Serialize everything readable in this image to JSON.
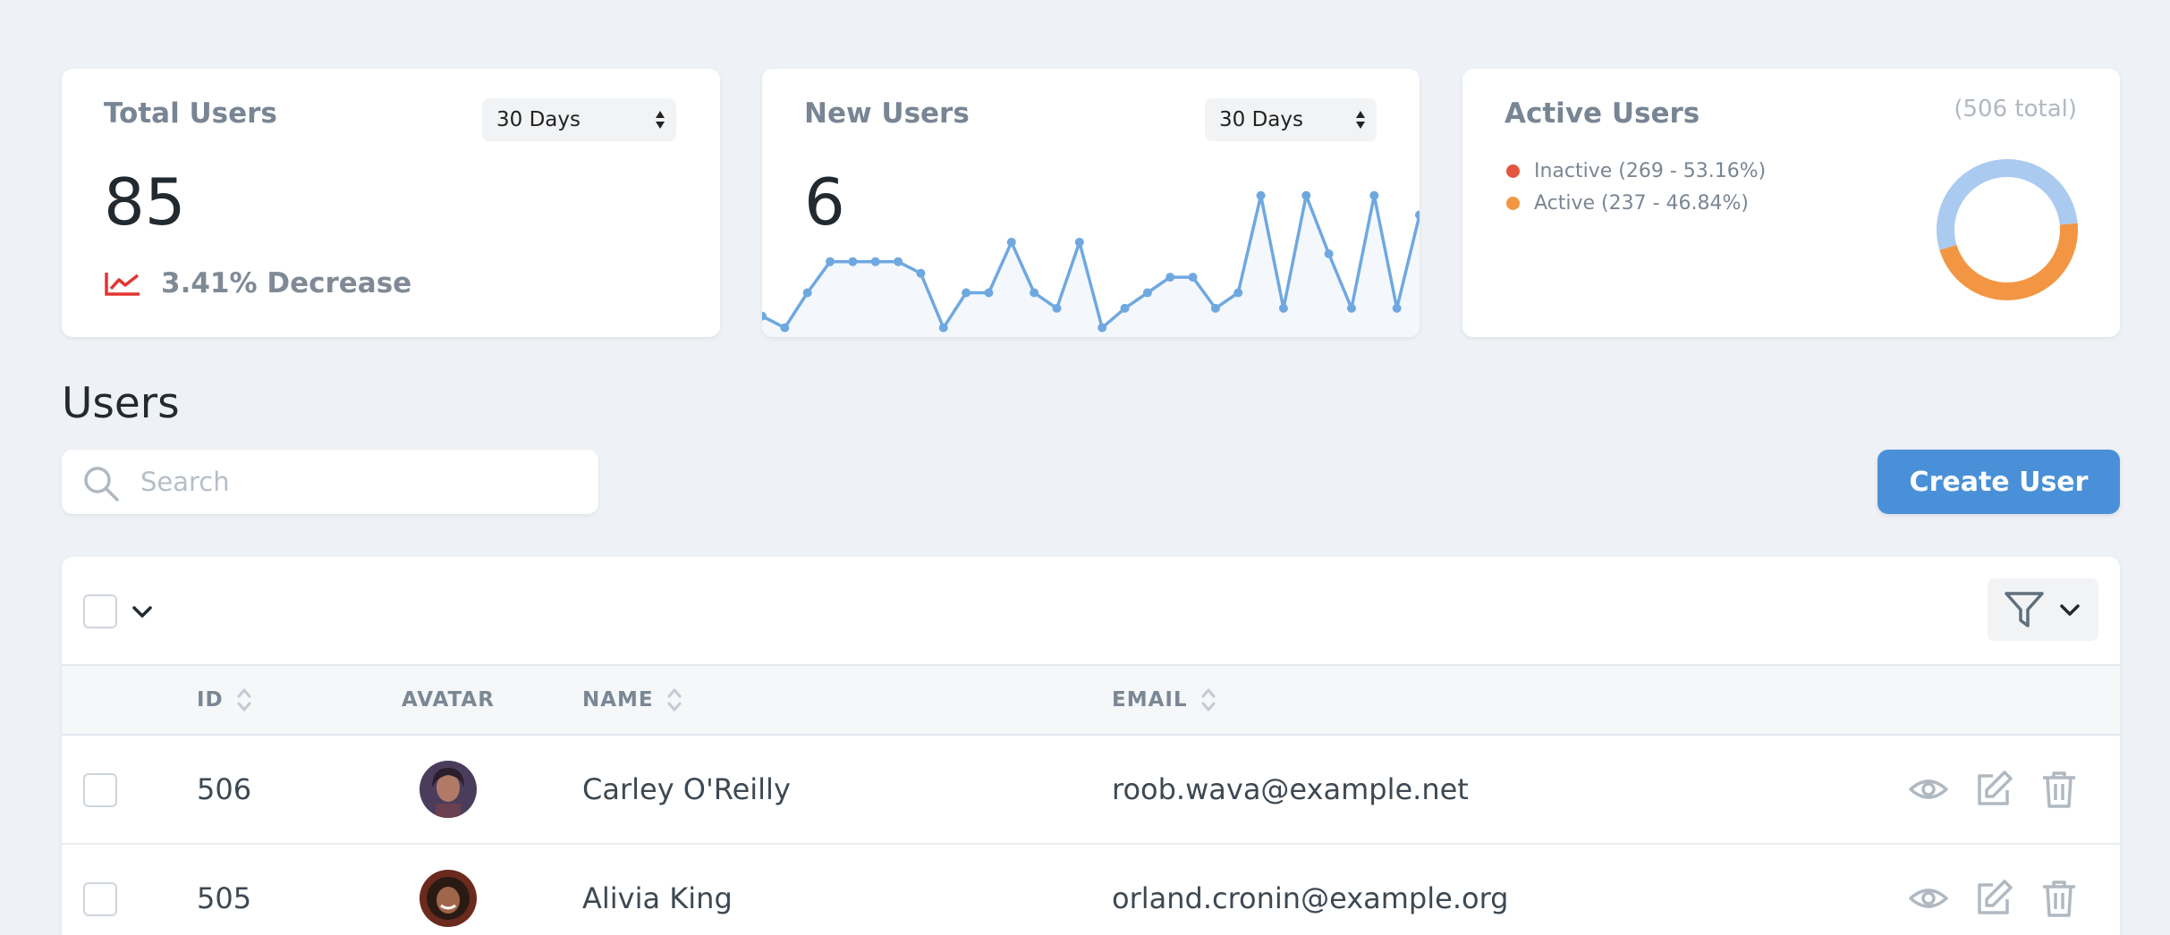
{
  "cards": {
    "total_users": {
      "title": "Total Users",
      "range": "30 Days",
      "value": "85",
      "trend_text": "3.41% Decrease",
      "trend_color": "#e3342f"
    },
    "new_users": {
      "title": "New Users",
      "range": "30 Days",
      "value": "6"
    },
    "active_users": {
      "title": "Active Users",
      "total_text": "(506 total)",
      "legend": [
        {
          "label": "Inactive (269 - 53.16%)",
          "color": "#e3573f"
        },
        {
          "label": "Active (237 - 46.84%)",
          "color": "#f29643"
        }
      ]
    }
  },
  "chart_data": [
    {
      "type": "area",
      "x": [
        1,
        2,
        3,
        4,
        5,
        6,
        7,
        8,
        9,
        10,
        11,
        12,
        13,
        14,
        15,
        16,
        17,
        18,
        19,
        20,
        21,
        22,
        23,
        24,
        25,
        26,
        27,
        28,
        29,
        30
      ],
      "values": [
        0.4,
        0.1,
        1,
        1.8,
        1.8,
        1.8,
        1.8,
        1.5,
        0.1,
        1,
        1,
        2.3,
        1,
        0.6,
        2.3,
        0.1,
        0.6,
        1,
        1.4,
        1.4,
        0.6,
        1,
        3.5,
        0.6,
        3.5,
        2,
        0.6,
        3.5,
        0.6,
        3
      ],
      "series_color": "#6fa8e0"
    },
    {
      "type": "pie",
      "categories": [
        "Inactive",
        "Active"
      ],
      "values": [
        269,
        237
      ],
      "colors": [
        "#aacbef",
        "#f29643"
      ]
    }
  ],
  "page": {
    "title": "Users"
  },
  "search": {
    "placeholder": "Search"
  },
  "create_button": "Create User",
  "table": {
    "columns": {
      "id": "ID",
      "avatar": "AVATAR",
      "name": "NAME",
      "email": "EMAIL"
    },
    "rows": [
      {
        "id": "506",
        "name": "Carley O'Reilly",
        "email": "roob.wava@example.net"
      },
      {
        "id": "505",
        "name": "Alivia King",
        "email": "orland.cronin@example.org"
      }
    ]
  },
  "colors": {
    "accent": "#4a90d9",
    "background": "#eef1f5"
  }
}
